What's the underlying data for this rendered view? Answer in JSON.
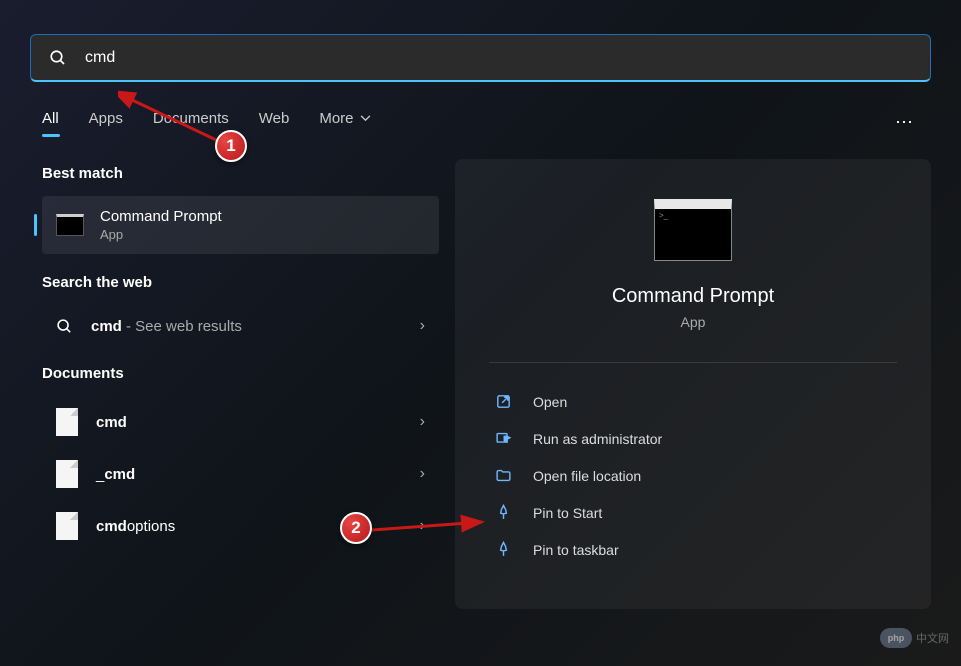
{
  "search": {
    "query": "cmd"
  },
  "tabs": {
    "all": "All",
    "apps": "Apps",
    "documents": "Documents",
    "web": "Web",
    "more": "More"
  },
  "sections": {
    "best_match": "Best match",
    "search_web": "Search the web",
    "documents": "Documents"
  },
  "best_match": {
    "title": "Command Prompt",
    "subtitle": "App"
  },
  "web_result": {
    "query_bold": "cmd",
    "suffix": " - See web results"
  },
  "documents": [
    {
      "bold": "cmd",
      "rest": ""
    },
    {
      "bold": "",
      "prefix": "_",
      "rest": "cmd"
    },
    {
      "bold": "cmd",
      "rest": "options"
    }
  ],
  "preview": {
    "title": "Command Prompt",
    "subtitle": "App"
  },
  "actions": {
    "open": "Open",
    "run_admin": "Run as administrator",
    "open_location": "Open file location",
    "pin_start": "Pin to Start",
    "pin_taskbar": "Pin to taskbar"
  },
  "annotations": {
    "badge1": "1",
    "badge2": "2"
  },
  "watermark": {
    "logo": "php",
    "text": "中文网"
  }
}
